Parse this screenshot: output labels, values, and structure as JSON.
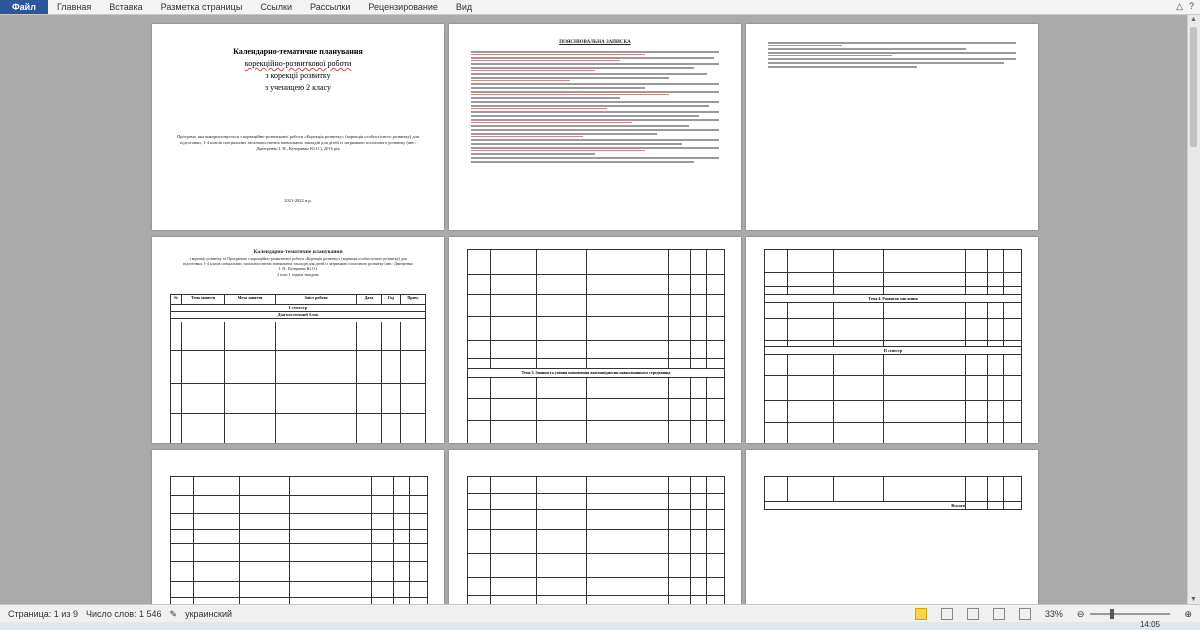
{
  "ribbon": {
    "tabs": [
      "Файл",
      "Главная",
      "Вставка",
      "Разметка страницы",
      "Ссылки",
      "Рассылки",
      "Рецензирование",
      "Вид"
    ]
  },
  "page1": {
    "title_lines": [
      "Календарно-тематичне планування",
      "корекційно-розвиткової роботи",
      "з корекції розвитку",
      "з ученицею 2 класу"
    ],
    "program_text": "Програма, яка використовується з корекційно-розвиткової роботи «Корекція розвитку» (корекція особистісного розвитку) для підготовки, 1-4 класів спеціальних загальноосвітніх навчальних закладів для дітей із затримкою психічного розвитку (авт.: Дмитренко І. Н., Кучерявко Ю.О.), 2016 рік",
    "year": "2021-2022 н.р."
  },
  "page2": {
    "title": "ПОЯСНЮВАЛЬНА ЗАПИСКА"
  },
  "page4": {
    "title": "Календарно-тематичне планування",
    "subtitle": "з корекції розвитку за Програмою з корекційно-розвиткової роботи «Корекція розвитку» (корекція особистісного розвитку) для підготовки, 1-4 класів спеціальних загальноосвітніх навчальних закладів для дітей із затримкою психічного розвитку (авт.: Дмитренко І. Н., Кучерявко Ю.О.)",
    "subtitle2": "2 клас 1 година тиждень",
    "headers": [
      "№",
      "Тема заняття",
      "Мета заняття",
      "Зміст роботи",
      "Дата",
      "Год",
      "Прим."
    ],
    "semester": "I семестр",
    "section": "Діагностичний блок"
  },
  "page5": {
    "section": "Тема 3. Знання та уміння визначення взаємовідносин навколишнього середовища"
  },
  "page6": {
    "section1": "Тема 4. Розвиток мислення",
    "section2": "II семестр"
  },
  "page9": {
    "total": "Всього"
  },
  "status": {
    "page": "Страница: 1 из 9",
    "words": "Число слов: 1 546",
    "language": "украинский",
    "zoom": "33%"
  },
  "taskbar": {
    "clock": "14:05"
  }
}
